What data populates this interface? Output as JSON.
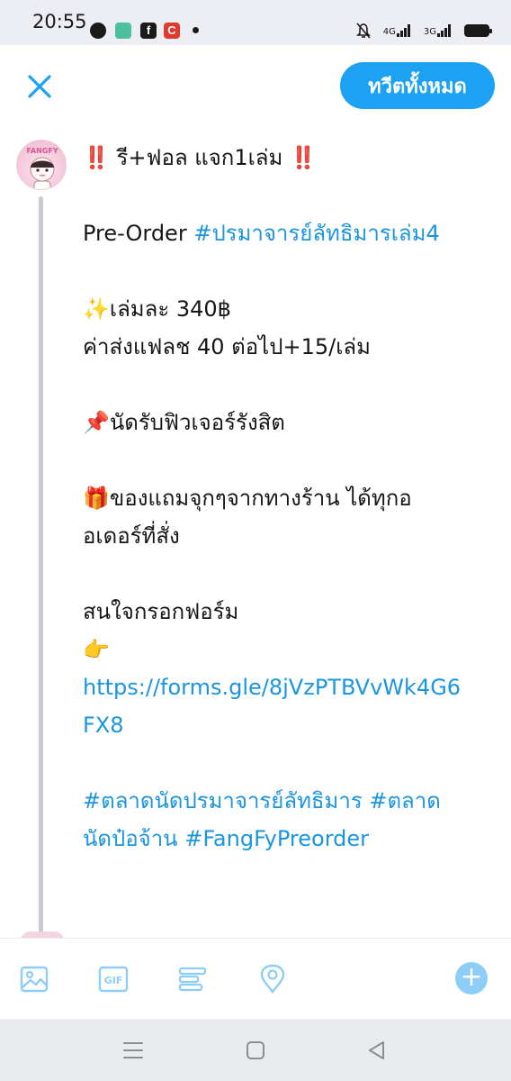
{
  "status_bar": {
    "time": "20:55",
    "signal_1": "4G",
    "signal_2": "3G",
    "notification_icons": [
      "messenger-icon",
      "message-icon",
      "facebook-icon",
      "c-app-icon",
      "dot-icon"
    ],
    "status_icons": [
      "mute-icon",
      "signal-icon",
      "signal-icon",
      "battery-icon"
    ]
  },
  "header": {
    "close_icon": "close-icon",
    "tweet_all_label": "ทวีตทั้งหมด",
    "accent_color": "#1da1f2"
  },
  "tweet": {
    "headline_emoji_left": "‼️",
    "headline_text": "รี+ฟอล แจก1เล่ม",
    "headline_emoji_right": "‼️",
    "preorder_prefix": "Pre-Order ",
    "preorder_hashtag": "#ปรมาจารย์ลัทธิมารเล่ม4",
    "price_emoji": "✨",
    "price_text": "เล่มละ 340฿",
    "shipping_text": "ค่าส่งแฟลช 40 ต่อไป+15/เล่ม",
    "pickup_emoji": "📌",
    "pickup_text": "นัดรับฟิวเจอร์รังสิต",
    "gift_emoji": "🎁",
    "gift_text_1": "ของแถมจุกๆจากทางร้าน ได้ทุกอ",
    "gift_text_2": "อเดอร์ที่สั่ง",
    "interest_text": "สนใจกรอกฟอร์ม",
    "point_emoji": "👉",
    "link_line_1": "https://forms.gle/8jVzPTBVvWk4G6",
    "link_line_2": "FX8",
    "hashtags_line_1": "#ตลาดนัดปรมาจารย์ลัทธิมาร #ตลาด",
    "hashtags_line_2": "นัดป๋อจ้าน #FangFyPreorder",
    "link_color": "#1b95e0"
  },
  "avatar": {
    "name": "avatar",
    "text": "FANGFY"
  },
  "toolbar": {
    "icons": [
      "image-icon",
      "gif-icon",
      "poll-icon",
      "location-icon"
    ],
    "gif_label": "GIF",
    "add_label": "+",
    "icon_color": "#8ecdf7"
  },
  "navbar": {
    "icons": [
      "menu-icon",
      "home-icon",
      "back-icon"
    ]
  }
}
